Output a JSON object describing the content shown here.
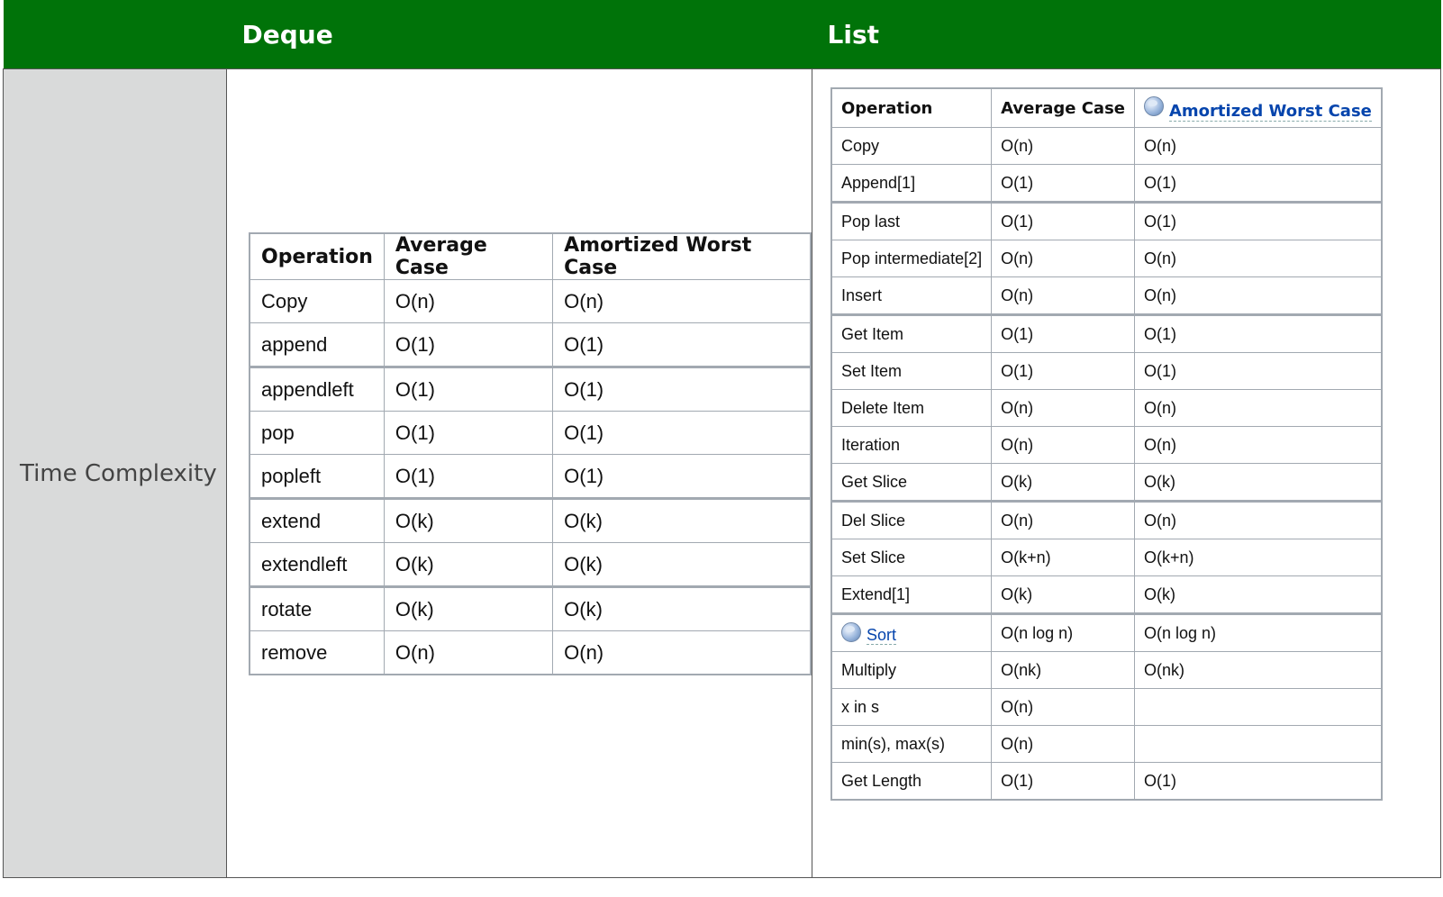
{
  "header": {
    "col1_label": "",
    "col2_label": "Deque",
    "col3_label": "List"
  },
  "row_label": "Time Complexity",
  "deque": {
    "headers": [
      "Operation",
      "Average Case",
      "Amortized Worst Case"
    ],
    "rows": [
      [
        "Copy",
        "O(n)",
        "O(n)"
      ],
      [
        "append",
        "O(1)",
        "O(1)"
      ],
      [
        "appendleft",
        "O(1)",
        "O(1)"
      ],
      [
        "pop",
        "O(1)",
        "O(1)"
      ],
      [
        "popleft",
        "O(1)",
        "O(1)"
      ],
      [
        "extend",
        "O(k)",
        "O(k)"
      ],
      [
        "extendleft",
        "O(k)",
        "O(k)"
      ],
      [
        "rotate",
        "O(k)",
        "O(k)"
      ],
      [
        "remove",
        "O(n)",
        "O(n)"
      ]
    ]
  },
  "list": {
    "headers": [
      "Operation",
      "Average Case",
      "Amortized Worst Case"
    ],
    "rows": [
      [
        "Copy",
        "O(n)",
        "O(n)"
      ],
      [
        "Append[1]",
        "O(1)",
        "O(1)"
      ],
      [
        "Pop last",
        "O(1)",
        "O(1)"
      ],
      [
        "Pop intermediate[2]",
        "O(n)",
        "O(n)"
      ],
      [
        "Insert",
        "O(n)",
        "O(n)"
      ],
      [
        "Get Item",
        "O(1)",
        "O(1)"
      ],
      [
        "Set Item",
        "O(1)",
        "O(1)"
      ],
      [
        "Delete Item",
        "O(n)",
        "O(n)"
      ],
      [
        "Iteration",
        "O(n)",
        "O(n)"
      ],
      [
        "Get Slice",
        "O(k)",
        "O(k)"
      ],
      [
        "Del Slice",
        "O(n)",
        "O(n)"
      ],
      [
        "Set Slice",
        "O(k+n)",
        "O(k+n)"
      ],
      [
        "Extend[1]",
        "O(k)",
        "O(k)"
      ],
      [
        "Sort",
        "O(n log n)",
        "O(n log n)"
      ],
      [
        "Multiply",
        "O(nk)",
        "O(nk)"
      ],
      [
        "x in s",
        "O(n)",
        ""
      ],
      [
        "min(s), max(s)",
        "O(n)",
        ""
      ],
      [
        "Get Length",
        "O(1)",
        "O(1)"
      ]
    ]
  },
  "icons": {
    "list_header_worst": "globe-icon",
    "list_sort": "globe-icon"
  },
  "colors": {
    "header_bg": "#007309",
    "header_text": "#ffffff",
    "label_bg": "#d9dada",
    "link": "#0645ad",
    "table_border": "#a2a9b1"
  }
}
